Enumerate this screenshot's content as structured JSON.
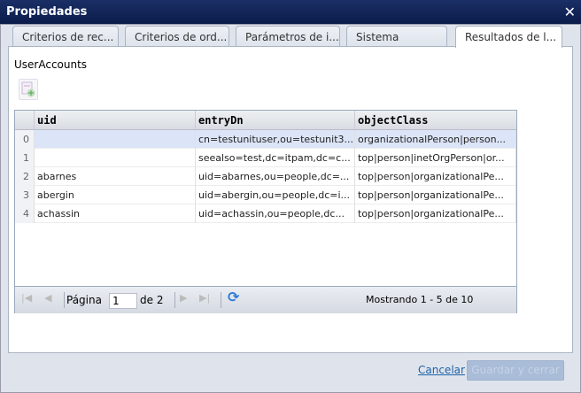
{
  "dialog": {
    "title": "Propiedades"
  },
  "tabs": [
    {
      "label": "Criterios de rec..."
    },
    {
      "label": "Criterios de ord..."
    },
    {
      "label": "Parámetros de i..."
    },
    {
      "label": "Sistema"
    },
    {
      "label": "Resultados de l..."
    }
  ],
  "section_label": "UserAccounts",
  "grid": {
    "columns": [
      "uid",
      "entryDn",
      "objectClass"
    ],
    "rows": [
      {
        "n": "0",
        "uid": "",
        "entryDn": "cn=testunituser,ou=testunit3...",
        "objectClass": "organizationalPerson|person..."
      },
      {
        "n": "1",
        "uid": "",
        "entryDn": "seealso=test,dc=itpam,dc=c...",
        "objectClass": "top|person|inetOrgPerson|or..."
      },
      {
        "n": "2",
        "uid": "abarnes",
        "entryDn": "uid=abarnes,ou=people,dc=...",
        "objectClass": "top|person|organizationalPe..."
      },
      {
        "n": "3",
        "uid": "abergin",
        "entryDn": "uid=abergin,ou=people,dc=i...",
        "objectClass": "top|person|organizationalPe..."
      },
      {
        "n": "4",
        "uid": "achassin",
        "entryDn": "uid=achassin,ou=people,dc...",
        "objectClass": "top|person|organizationalPe..."
      }
    ]
  },
  "pager": {
    "page_label": "Página",
    "page": "1",
    "of_label": "de 2",
    "status": "Mostrando 1 - 5 de 10"
  },
  "footer": {
    "cancel": "Cancelar",
    "save": "Guardar y cerrar"
  }
}
